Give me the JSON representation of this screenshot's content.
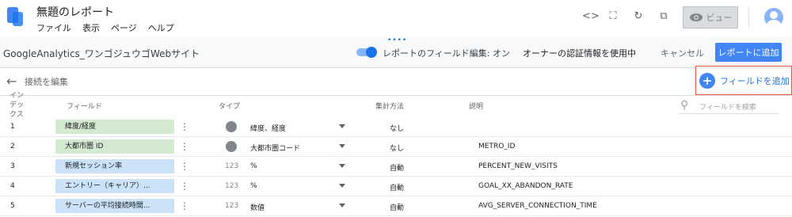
{
  "header": {
    "title": "無題のレポート",
    "menu": [
      "ファイル",
      "表示",
      "ページ",
      "ヘルプ"
    ],
    "view_label": "ビュー"
  },
  "toolbar": {
    "data_source_name": "GoogleAnalytics_ワンゴジュウゴWebサイト",
    "field_edit_toggle_label": "レポートのフィールド編集: オン",
    "owner_credentials_label": "オーナーの認証情報を使用中",
    "cancel_label": "キャンセル",
    "add_to_report_label": "レポートに追加"
  },
  "subbar": {
    "edit_connection_label": "接続を編集",
    "add_field_label": "フィールドを追加"
  },
  "table": {
    "headers": {
      "index": "インデックス",
      "field": "フィールド",
      "type": "タイプ",
      "aggregation": "集計方法",
      "description": "説明"
    },
    "search_placeholder": "フィールドを検索",
    "rows": [
      {
        "index": "1",
        "field": "緯度/経度",
        "kind": "dimension",
        "type_icon": "globe-icon",
        "type": "緯度、経度",
        "aggregation": "なし",
        "description": ""
      },
      {
        "index": "2",
        "field": "大都市圏 ID",
        "kind": "dimension",
        "type_icon": "globe-icon",
        "type": "大都市圏コード",
        "aggregation": "なし",
        "description": "METRO_ID"
      },
      {
        "index": "3",
        "field": "新規セッション率",
        "kind": "metric",
        "type_icon": "123",
        "type": "%",
        "aggregation": "自動",
        "description": "PERCENT_NEW_VISITS"
      },
      {
        "index": "4",
        "field": "エントリー（キャリア）...",
        "kind": "metric",
        "type_icon": "123",
        "type": "%",
        "aggregation": "自動",
        "description": "GOAL_XX_ABANDON_RATE"
      },
      {
        "index": "5",
        "field": "サーバーの平均接続時間...",
        "kind": "metric",
        "type_icon": "123",
        "type": "数値",
        "aggregation": "自動",
        "description": "AVG_SERVER_CONNECTION_TIME"
      }
    ]
  },
  "colors": {
    "accent": "#4285f4",
    "dimension_chip": "#d4ead0",
    "metric_chip": "#cbe2f8",
    "highlight_border": "#e8553e"
  }
}
